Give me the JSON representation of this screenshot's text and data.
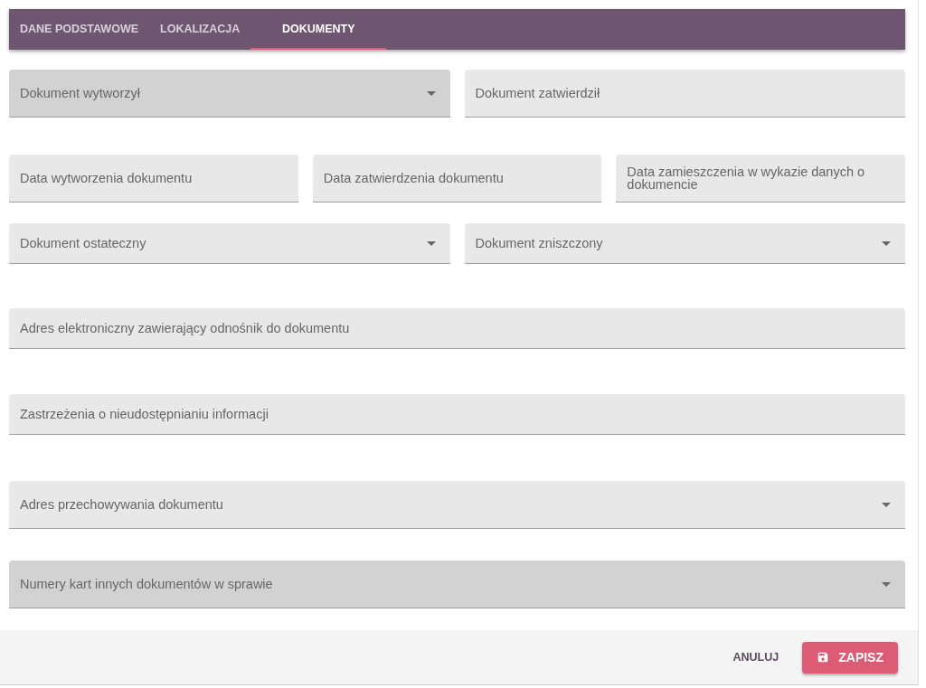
{
  "tabs": [
    {
      "label": "DANE PODSTAWOWE",
      "selected": false
    },
    {
      "label": "LOKALIZACJA",
      "selected": false
    },
    {
      "label": "DOKUMENTY",
      "selected": true
    }
  ],
  "rows": [
    {
      "fields": [
        {
          "label": "Dokument wytworzył",
          "kind": "select",
          "highlighted": true
        },
        {
          "label": "Dokument zatwierdził",
          "kind": "text",
          "highlighted": false
        }
      ]
    },
    {
      "fields": [
        {
          "label": "Data wytworzenia dokumentu",
          "kind": "text",
          "highlighted": false
        },
        {
          "label": "Data zatwierdzenia dokumentu",
          "kind": "text",
          "highlighted": false
        },
        {
          "label": "Data zamieszczenia w wykazie danych o dokumencie",
          "kind": "text",
          "highlighted": false
        }
      ]
    },
    {
      "fields": [
        {
          "label": "Dokument ostateczny",
          "kind": "select",
          "highlighted": false
        },
        {
          "label": "Dokument zniszczony",
          "kind": "select",
          "highlighted": false
        }
      ]
    },
    {
      "fields": [
        {
          "label": "Adres elektroniczny zawierający odnośnik do dokumentu",
          "kind": "text",
          "highlighted": false
        }
      ]
    },
    {
      "fields": [
        {
          "label": "Zastrzeżenia o nieudostępnianiu informacji",
          "kind": "text",
          "highlighted": false
        }
      ]
    },
    {
      "fields": [
        {
          "label": "Adres przechowywania dokumentu",
          "kind": "select",
          "highlighted": false
        }
      ]
    },
    {
      "fields": [
        {
          "label": "Numery kart innych dokumentów w sprawie",
          "kind": "select",
          "highlighted": true
        }
      ]
    }
  ],
  "footer": {
    "cancel": "ANULUJ",
    "save": "ZAPISZ"
  }
}
